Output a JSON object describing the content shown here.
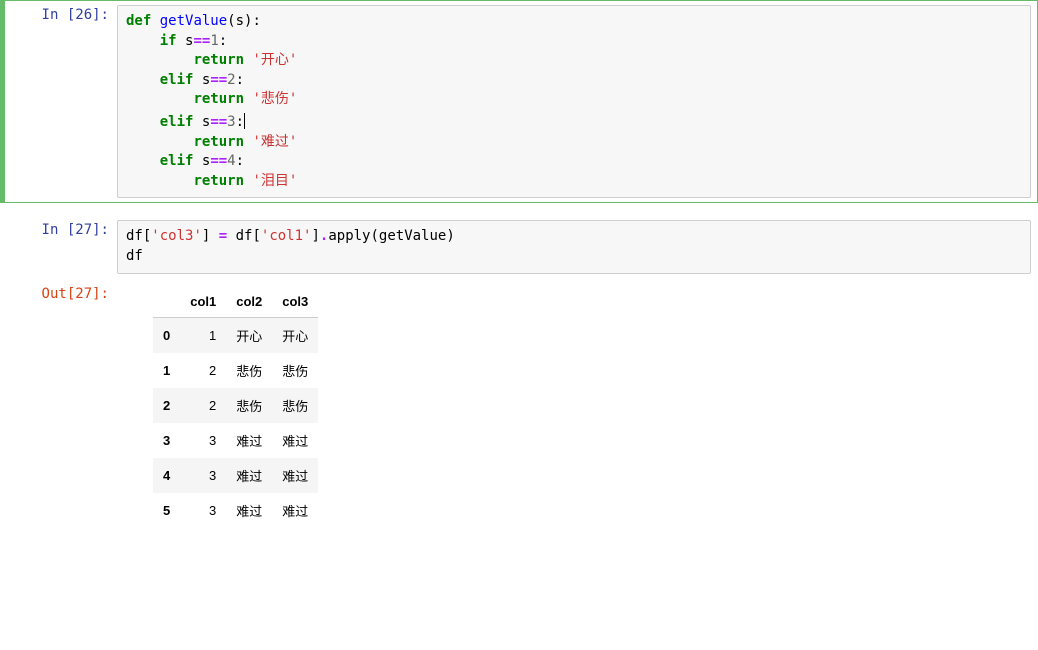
{
  "cells": {
    "code1": {
      "prompt_label": "In ",
      "prompt_num": "[26]:",
      "tokens": {
        "def": "def",
        "fn": "getValue",
        "paren_o": "(",
        "arg": "s",
        "paren_c": ")",
        "colon": ":",
        "if": "if",
        "s": "s",
        "eq": "==",
        "n1": "1",
        "n2": "2",
        "n3": "3",
        "n4": "4",
        "elif": "elif",
        "return": "return",
        "v1": "'开心'",
        "v2": "'悲伤'",
        "v3": "'难过'",
        "v4": "'泪目'",
        "col": ":"
      }
    },
    "code2": {
      "prompt_label": "In ",
      "prompt_num": "[27]:",
      "line1_tokens": {
        "a": "df[",
        "s1": "'col3'",
        "b": "] ",
        "eq": "=",
        "c": " df[",
        "s2": "'col1'",
        "d": "]",
        "e": ".",
        "f": "apply(getValue)"
      },
      "line2": "df"
    },
    "out2": {
      "prompt_label": "Out",
      "prompt_num": "[27]:",
      "headers": [
        "",
        "col1",
        "col2",
        "col3"
      ],
      "rows": [
        {
          "idx": "0",
          "c1": "1",
          "c2": "开心",
          "c3": "开心"
        },
        {
          "idx": "1",
          "c1": "2",
          "c2": "悲伤",
          "c3": "悲伤"
        },
        {
          "idx": "2",
          "c1": "2",
          "c2": "悲伤",
          "c3": "悲伤"
        },
        {
          "idx": "3",
          "c1": "3",
          "c2": "难过",
          "c3": "难过"
        },
        {
          "idx": "4",
          "c1": "3",
          "c2": "难过",
          "c3": "难过"
        },
        {
          "idx": "5",
          "c1": "3",
          "c2": "难过",
          "c3": "难过"
        }
      ]
    }
  }
}
